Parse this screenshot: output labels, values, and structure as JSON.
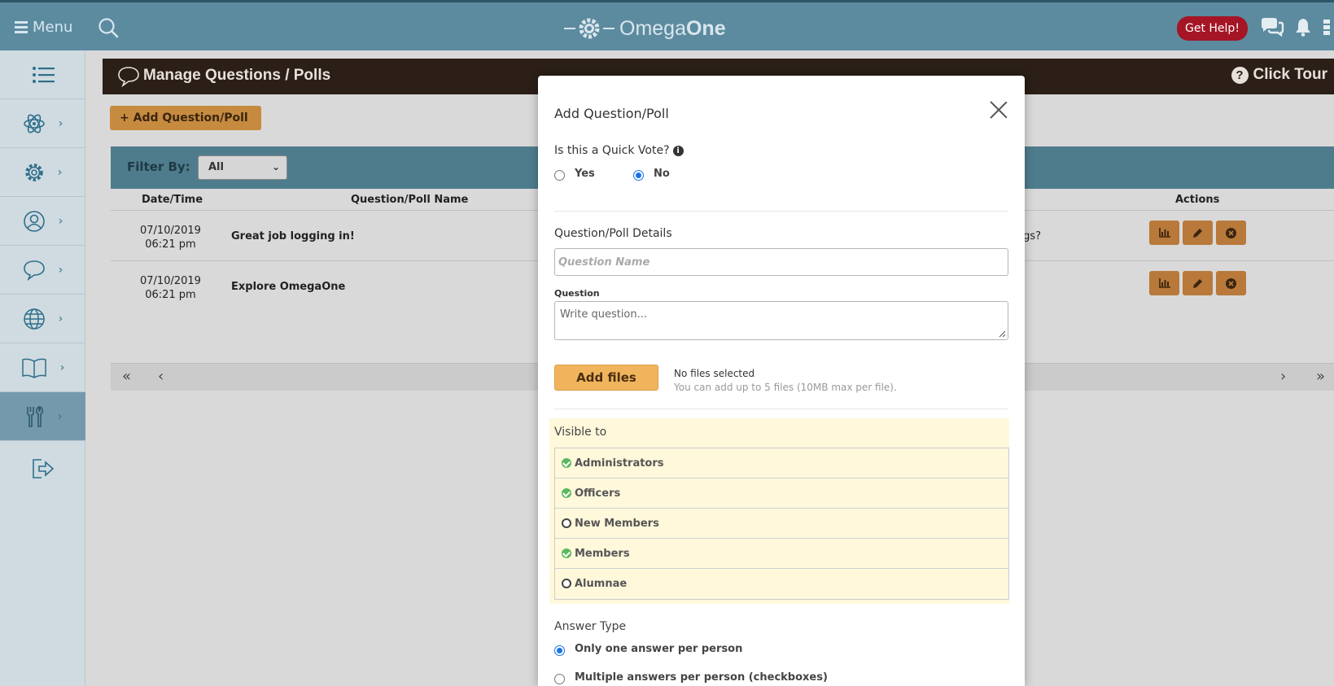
{
  "topbar": {
    "menu_label": "Menu",
    "logo_light": "Omega",
    "logo_bold": "One",
    "help_label": "Get Help!"
  },
  "sidebar": {
    "items": [
      {
        "icon": "list-icon"
      },
      {
        "icon": "atom-icon"
      },
      {
        "icon": "gear-icon"
      },
      {
        "icon": "user-icon"
      },
      {
        "icon": "chat-icon"
      },
      {
        "icon": "globe-icon"
      },
      {
        "icon": "book-icon"
      },
      {
        "icon": "tools-icon",
        "active": true
      },
      {
        "icon": "logout-icon"
      }
    ]
  },
  "page": {
    "title": "Manage Questions / Polls",
    "tour_label": "Click Tour",
    "add_button": "+ Add Question/Poll",
    "filter_label": "Filter By:",
    "filter_value": "All",
    "columns": {
      "datetime": "Date/Time",
      "name": "Question/Poll Name",
      "actions": "Actions"
    },
    "rows": [
      {
        "date": "07/10/2019",
        "time": "06:21 pm",
        "name": "Great job logging in!",
        "extra": "r meetings?"
      },
      {
        "date": "07/10/2019",
        "time": "06:21 pm",
        "name": "Explore OmegaOne",
        "extra": ""
      }
    ]
  },
  "modal": {
    "title": "Add Question/Poll",
    "quick_vote_label": "Is this a Quick Vote?",
    "yes_label": "Yes",
    "no_label": "No",
    "quick_vote_selected": "No",
    "details_label": "Question/Poll Details",
    "name_placeholder": "Question Name",
    "question_label": "Question",
    "question_placeholder": "Write question...",
    "add_files_label": "Add files",
    "no_files": "No files selected",
    "files_hint": "You can add up to 5 files (10MB max per file).",
    "visible_label": "Visible to",
    "visible_items": [
      {
        "label": "Administrators",
        "checked": true
      },
      {
        "label": "Officers",
        "checked": true
      },
      {
        "label": "New Members",
        "checked": false
      },
      {
        "label": "Members",
        "checked": true
      },
      {
        "label": "Alumnae",
        "checked": false
      }
    ],
    "answer_type_label": "Answer Type",
    "answer_one": "Only one answer per person",
    "answer_multi": "Multiple answers per person (checkboxes)",
    "answer_selected": "one"
  },
  "colors": {
    "topbar": "#5c8ba0",
    "title_bar": "#2b1f17",
    "accent_orange": "#f0b55c",
    "help_red": "#a51525",
    "visible_bg": "#fff8db"
  }
}
